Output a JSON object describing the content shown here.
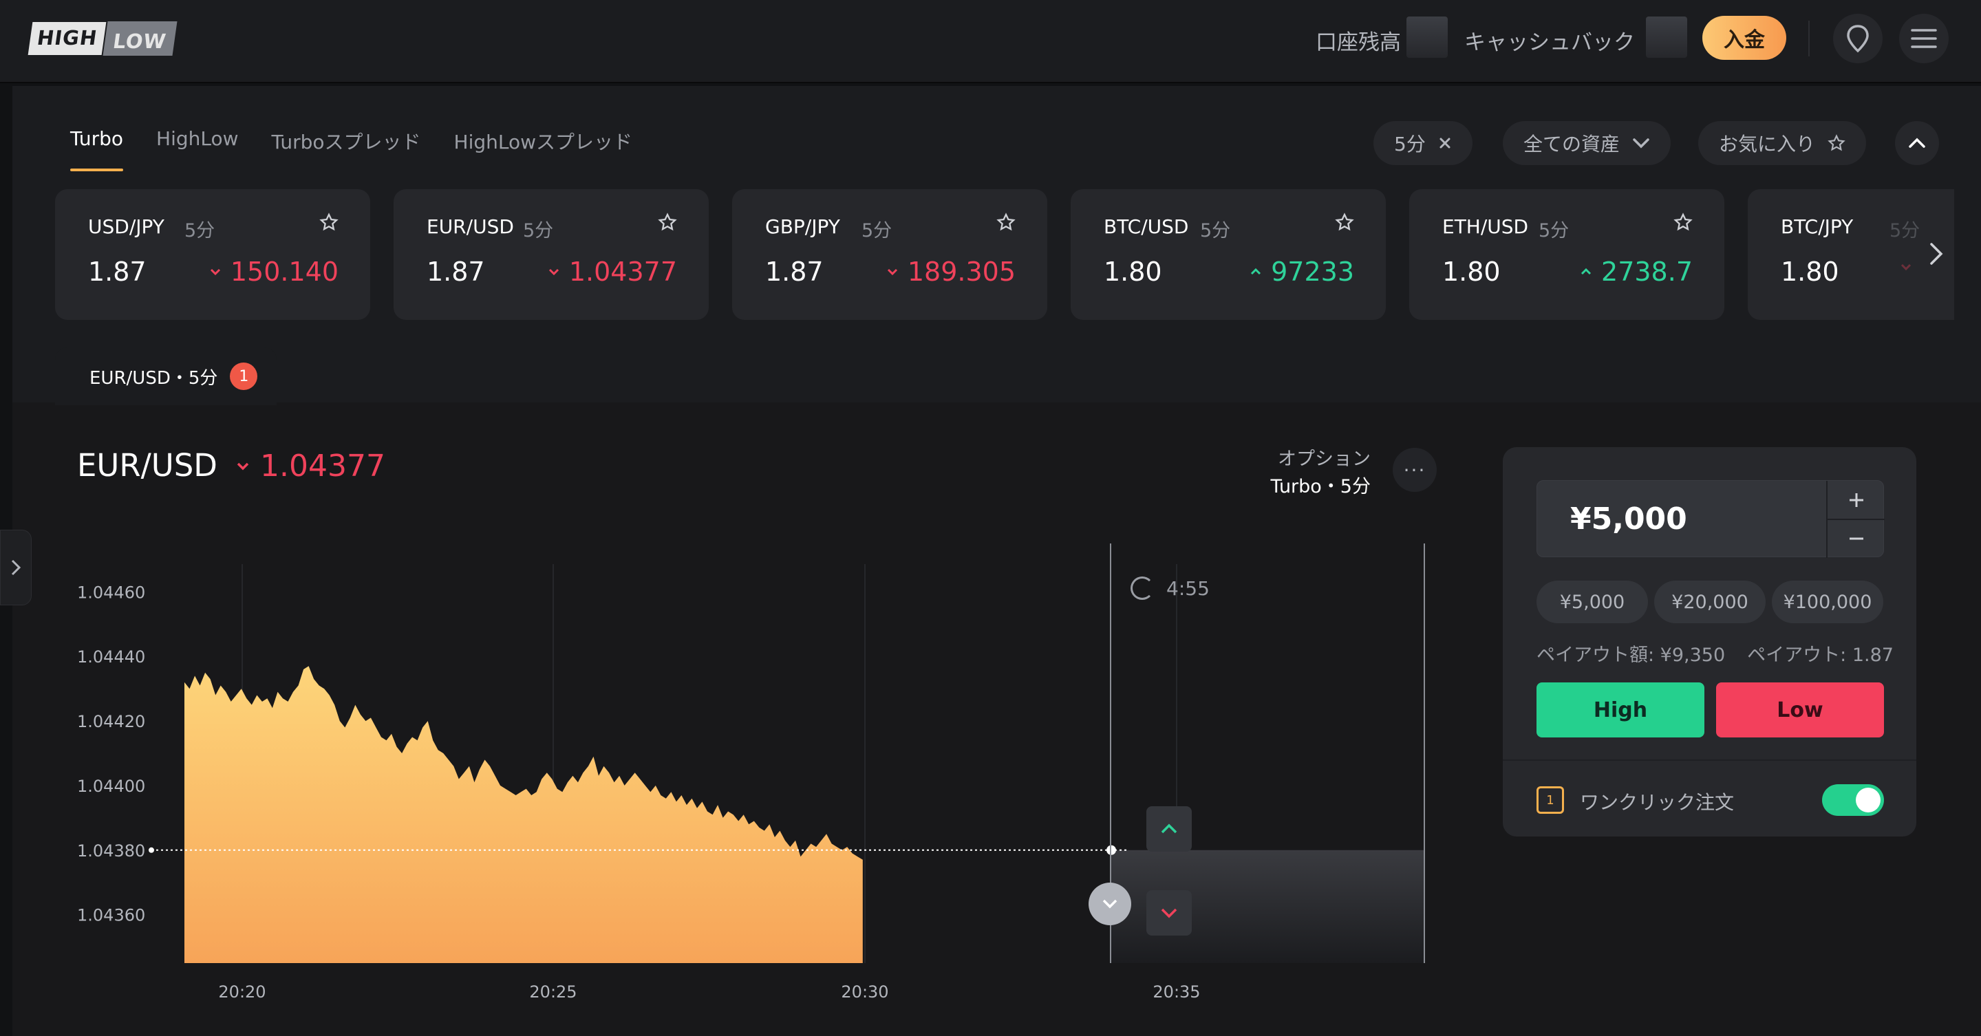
{
  "header": {
    "logo_high": "HIGH",
    "logo_low": "LOW",
    "balance_label": "口座残高",
    "cashback_label": "キャッシュバック",
    "deposit_label": "入金"
  },
  "tabs": [
    {
      "label": "Turbo",
      "active": true
    },
    {
      "label": "HighLow",
      "active": false
    },
    {
      "label": "Turboスプレッド",
      "active": false
    },
    {
      "label": "HighLowスプレッド",
      "active": false
    }
  ],
  "filters": {
    "duration": "5分",
    "assets": "全ての資産",
    "favorites": "お気に入り"
  },
  "assets": [
    {
      "name": "USD/JPY",
      "duration": "5分",
      "payout": "1.87",
      "price": "150.140",
      "direction": "down"
    },
    {
      "name": "EUR/USD",
      "duration": "5分",
      "payout": "1.87",
      "price": "1.04377",
      "direction": "down"
    },
    {
      "name": "GBP/JPY",
      "duration": "5分",
      "payout": "1.87",
      "price": "189.305",
      "direction": "down"
    },
    {
      "name": "BTC/USD",
      "duration": "5分",
      "payout": "1.80",
      "price": "97233",
      "direction": "up"
    },
    {
      "name": "ETH/USD",
      "duration": "5分",
      "payout": "1.80",
      "price": "2738.7",
      "direction": "up"
    },
    {
      "name": "BTC/JPY",
      "duration": "5分",
      "payout": "1.80",
      "price": "",
      "direction": "down"
    }
  ],
  "chart_tab": {
    "label": "EUR/USD・5分",
    "badge": "1"
  },
  "chart_header": {
    "symbol": "EUR/USD",
    "price": "1.04377",
    "option_label": "オプション",
    "option_value": "Turbo・5分"
  },
  "timer": "4:55",
  "order": {
    "amount": "¥5,000",
    "presets": [
      "¥5,000",
      "¥20,000",
      "¥100,000"
    ],
    "payout_amount": "ペイアウト額: ¥9,350",
    "payout_rate": "ペイアウト: 1.87",
    "high_label": "High",
    "low_label": "Low",
    "oneclick_label": "ワンクリック注文",
    "oneclick_icon_text": "1",
    "oneclick_enabled": true
  },
  "colors": {
    "up": "#2fd39a",
    "down": "#f0425b",
    "accent": "#f4b04e",
    "high": "#25d08e",
    "low": "#f3405c"
  },
  "chart_data": {
    "type": "area",
    "series_color_top": "#fdd57a",
    "series_color_bottom": "#f7a458",
    "x_ticks": [
      "20:20",
      "20:25",
      "20:30",
      "20:35"
    ],
    "y_ticks": [
      "1.04460",
      "1.04440",
      "1.04420",
      "1.04400",
      "1.04380",
      "1.04360"
    ],
    "ylim": [
      1.04345,
      1.04475
    ],
    "current_level": 1.0438,
    "x": [
      0,
      5,
      10,
      15,
      20,
      25,
      30,
      35,
      40,
      45,
      50,
      55,
      60,
      65,
      70,
      75,
      80,
      85,
      90,
      95,
      100,
      105,
      110,
      115,
      120,
      125,
      130,
      135,
      140,
      145,
      150,
      155,
      160,
      165,
      170,
      175,
      180,
      185,
      190,
      195,
      200,
      205,
      210,
      215,
      220,
      225,
      230,
      235,
      240,
      245,
      250,
      255,
      260,
      265,
      270,
      275,
      280,
      285,
      290,
      295,
      300,
      305,
      310,
      315,
      320,
      325,
      330,
      335,
      340,
      345,
      350,
      355,
      360,
      365,
      370,
      375,
      380,
      385,
      390,
      395,
      400,
      405,
      410,
      415,
      420,
      425,
      430,
      435,
      440,
      445,
      450,
      455,
      460,
      465,
      470,
      475,
      480,
      485,
      490,
      495,
      500,
      505,
      510,
      515,
      520,
      525,
      530,
      535,
      540,
      545,
      550,
      555,
      560,
      565,
      570,
      575,
      580,
      585,
      590,
      595,
      600,
      605,
      610,
      615,
      620,
      625,
      630,
      635,
      640,
      645,
      650,
      655,
      660,
      665,
      670,
      675,
      680,
      685,
      690,
      695,
      700,
      705,
      710,
      715,
      720,
      725,
      730,
      735,
      740,
      745,
      750,
      755,
      760,
      765,
      770,
      775,
      780,
      785,
      790,
      795,
      800,
      805,
      810,
      815,
      820,
      825,
      830,
      835,
      840,
      845,
      850,
      855,
      860,
      865,
      870,
      875,
      880,
      885,
      890,
      895
    ],
    "values": [
      1.04432,
      1.0443,
      1.04434,
      1.04431,
      1.04435,
      1.04433,
      1.04428,
      1.04431,
      1.04429,
      1.04426,
      1.04428,
      1.0443,
      1.04427,
      1.04425,
      1.04428,
      1.04426,
      1.04427,
      1.04424,
      1.04429,
      1.04427,
      1.04426,
      1.04429,
      1.04431,
      1.04436,
      1.04437,
      1.04433,
      1.04431,
      1.0443,
      1.04428,
      1.04425,
      1.0442,
      1.04418,
      1.04421,
      1.04425,
      1.04422,
      1.0442,
      1.04421,
      1.04418,
      1.04415,
      1.04414,
      1.04416,
      1.04412,
      1.0441,
      1.04413,
      1.04415,
      1.04414,
      1.04418,
      1.0442,
      1.04414,
      1.04411,
      1.0441,
      1.04408,
      1.04406,
      1.04402,
      1.04404,
      1.04406,
      1.04401,
      1.04405,
      1.04408,
      1.04406,
      1.04403,
      1.044,
      1.04399,
      1.04398,
      1.04397,
      1.04398,
      1.04399,
      1.04397,
      1.04398,
      1.04402,
      1.04404,
      1.04402,
      1.04399,
      1.04398,
      1.04401,
      1.04403,
      1.04401,
      1.04404,
      1.04406,
      1.04409,
      1.04403,
      1.04406,
      1.04404,
      1.04401,
      1.04403,
      1.044,
      1.04402,
      1.04404,
      1.04402,
      1.044,
      1.04398,
      1.044,
      1.04397,
      1.04396,
      1.04398,
      1.04395,
      1.04397,
      1.04394,
      1.04396,
      1.04393,
      1.04395,
      1.04392,
      1.04391,
      1.04394,
      1.0439,
      1.04392,
      1.04391,
      1.04389,
      1.04391,
      1.04388,
      1.04389,
      1.04387,
      1.04386,
      1.04388,
      1.04384,
      1.04386,
      1.04383,
      1.04381,
      1.04383,
      1.04378,
      1.0438,
      1.04382,
      1.04381,
      1.04383,
      1.04385,
      1.04382,
      1.04381,
      1.0438,
      1.04381,
      1.04379,
      1.04378,
      1.04377
    ]
  }
}
